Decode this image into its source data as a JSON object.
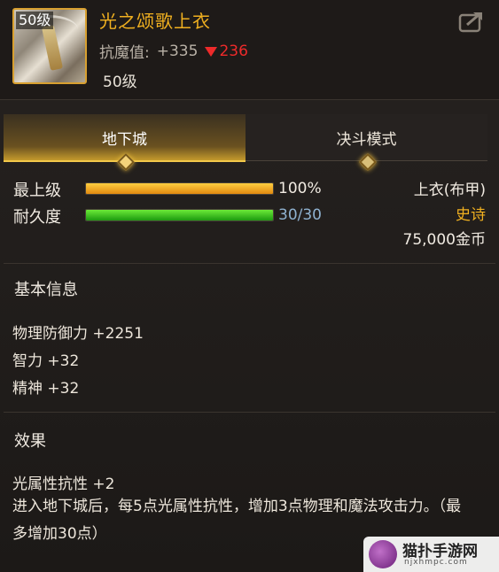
{
  "item": {
    "thumb_level": "50级",
    "name": "光之颂歌上衣",
    "resist_label": "抗魔值:",
    "resist_value": "+335",
    "resist_change": "236",
    "required_level": "50级"
  },
  "tabs": [
    {
      "label": "地下城",
      "active": true
    },
    {
      "label": "决斗模式",
      "active": false
    }
  ],
  "stats": {
    "level_label": "最上级",
    "level_value": "100%",
    "level_fraction": 1.0,
    "durability_label": "耐久度",
    "durability_value": "30/30",
    "durability_fraction": 1.0
  },
  "info": {
    "slot": "上衣(布甲)",
    "rarity": "史诗",
    "price": "75,000金币"
  },
  "basic": {
    "title": "基本信息",
    "lines": [
      "物理防御力 +2251",
      "智力 +32",
      "精神 +32"
    ]
  },
  "effect": {
    "title": "效果",
    "line1": "光属性抗性 +2",
    "line2": "进入地下城后，每5点光属性抗性，增加3点物理和魔法攻击力。（最多增加30点）"
  },
  "watermark": {
    "name": "猫扑手游网",
    "url": "njxhmpc.com"
  },
  "colors": {
    "item_name": "#f0b020",
    "rarity": "#f0b020",
    "decrease": "#ee2a2a",
    "durability_value": "#8fb2d0"
  }
}
